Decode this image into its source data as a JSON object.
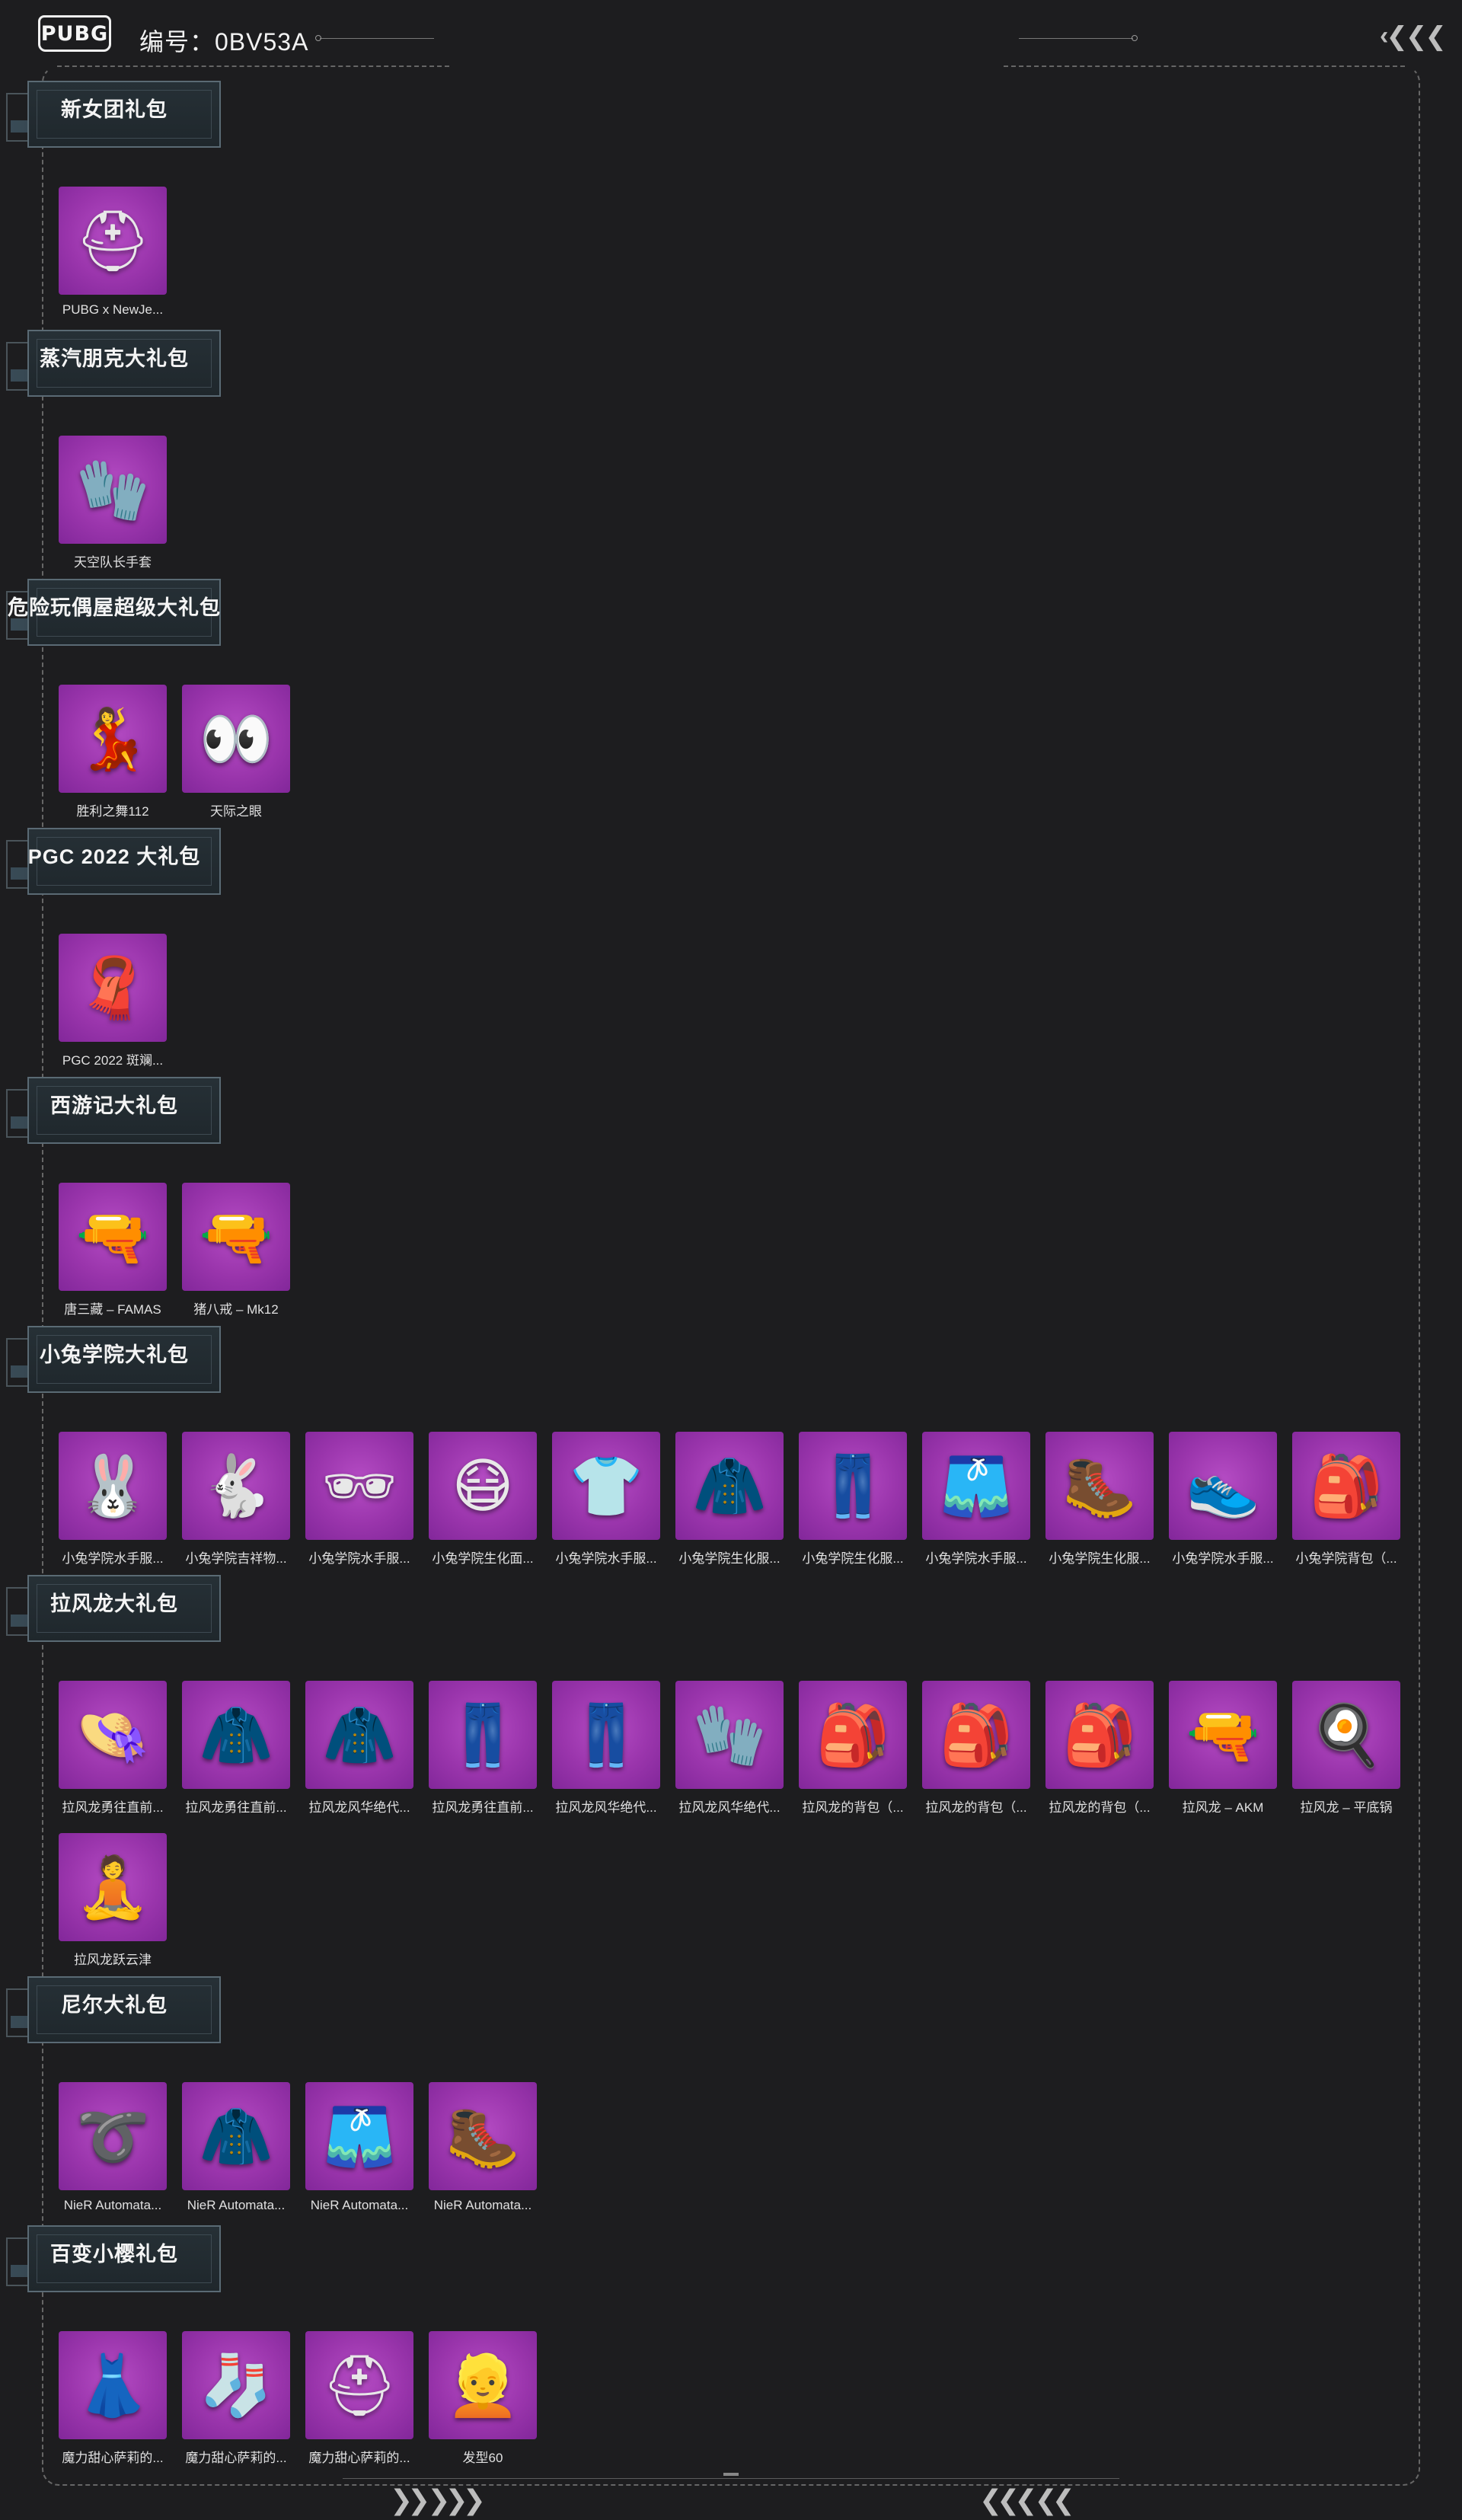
{
  "header": {
    "logo_text": "PUBG",
    "serial_label": "编号：0BV53A"
  },
  "sections": [
    {
      "title": "新女团礼包",
      "items": [
        {
          "name": "PUBG x NewJe...",
          "icon": "helmet-icon"
        }
      ]
    },
    {
      "title": "蒸汽朋克大礼包",
      "items": [
        {
          "name": "天空队长手套",
          "icon": "gloves-icon"
        }
      ]
    },
    {
      "title": "危险玩偶屋超级大礼包",
      "items": [
        {
          "name": "胜利之舞112",
          "icon": "dance-emote-icon"
        },
        {
          "name": "天际之眼",
          "icon": "eyes-sky-icon"
        }
      ]
    },
    {
      "title": "PGC 2022 大礼包",
      "items": [
        {
          "name": "PGC 2022 斑斓...",
          "icon": "scarf-icon"
        }
      ]
    },
    {
      "title": "西游记大礼包",
      "items": [
        {
          "name": "唐三藏 – FAMAS",
          "icon": "rifle-icon"
        },
        {
          "name": "猪八戒 – Mk12",
          "icon": "rifle-icon"
        }
      ]
    },
    {
      "title": "小兔学院大礼包",
      "items": [
        {
          "name": "小兔学院水手服...",
          "icon": "bunny-hat-icon"
        },
        {
          "name": "小兔学院吉祥物...",
          "icon": "bunny-mask-icon"
        },
        {
          "name": "小兔学院水手服...",
          "icon": "glasses-icon"
        },
        {
          "name": "小兔学院生化面...",
          "icon": "gas-mask-icon"
        },
        {
          "name": "小兔学院水手服...",
          "icon": "shirt-icon"
        },
        {
          "name": "小兔学院生化服...",
          "icon": "jacket-icon"
        },
        {
          "name": "小兔学院生化服...",
          "icon": "pants-icon"
        },
        {
          "name": "小兔学院水手服...",
          "icon": "skirt-icon"
        },
        {
          "name": "小兔学院生化服...",
          "icon": "boots-icon"
        },
        {
          "name": "小兔学院水手服...",
          "icon": "shoes-icon"
        },
        {
          "name": "小兔学院背包（...",
          "icon": "backpack-icon"
        }
      ]
    },
    {
      "title": "拉风龙大礼包",
      "items": [
        {
          "name": "拉风龙勇往直前...",
          "icon": "bucket-hat-icon"
        },
        {
          "name": "拉风龙勇往直前...",
          "icon": "jacket-icon"
        },
        {
          "name": "拉风龙风华绝代...",
          "icon": "jacket-icon"
        },
        {
          "name": "拉风龙勇往直前...",
          "icon": "pants-icon"
        },
        {
          "name": "拉风龙风华绝代...",
          "icon": "pants-icon"
        },
        {
          "name": "拉风龙风华绝代...",
          "icon": "gloves-icon"
        },
        {
          "name": "拉风龙的背包（...",
          "icon": "backpack-icon"
        },
        {
          "name": "拉风龙的背包（...",
          "icon": "backpack-icon"
        },
        {
          "name": "拉风龙的背包（...",
          "icon": "backpack-icon"
        },
        {
          "name": "拉风龙 – AKM",
          "icon": "rifle-icon"
        },
        {
          "name": "拉风龙 – 平底锅",
          "icon": "pan-icon"
        },
        {
          "name": "拉风龙跃云津",
          "icon": "meditate-emote-icon"
        }
      ]
    },
    {
      "title": "尼尔大礼包",
      "items": [
        {
          "name": "NieR Automata...",
          "icon": "belt-icon"
        },
        {
          "name": "NieR Automata...",
          "icon": "coat-icon"
        },
        {
          "name": "NieR Automata...",
          "icon": "shorts-icon"
        },
        {
          "name": "NieR Automata...",
          "icon": "boots-icon"
        }
      ]
    },
    {
      "title": "百变小樱礼包",
      "items": [
        {
          "name": "魔力甜心萨莉的...",
          "icon": "dress-icon"
        },
        {
          "name": "魔力甜心萨莉的...",
          "icon": "stockings-icon"
        },
        {
          "name": "魔力甜心萨莉的...",
          "icon": "helmet-icon"
        },
        {
          "name": "发型60",
          "icon": "hairstyle-icon"
        }
      ]
    }
  ],
  "icon_glyphs": {
    "helmet-icon": "⛑",
    "gloves-icon": "🧤",
    "dance-emote-icon": "💃",
    "eyes-sky-icon": "👀",
    "scarf-icon": "🧣",
    "rifle-icon": "🔫",
    "bunny-hat-icon": "🐰",
    "bunny-mask-icon": "🐇",
    "glasses-icon": "🕶",
    "gas-mask-icon": "😷",
    "shirt-icon": "👕",
    "jacket-icon": "🧥",
    "pants-icon": "👖",
    "skirt-icon": "🩳",
    "boots-icon": "🥾",
    "shoes-icon": "👟",
    "backpack-icon": "🎒",
    "bucket-hat-icon": "👒",
    "pan-icon": "🍳",
    "meditate-emote-icon": "🧘",
    "belt-icon": "➰",
    "coat-icon": "🧥",
    "shorts-icon": "🩳",
    "dress-icon": "👗",
    "stockings-icon": "🧦",
    "hairstyle-icon": "👱"
  },
  "colors": {
    "background": "#1d1d1f",
    "thumb_purple": "#9a35ac",
    "frame_dash": "#666666"
  }
}
